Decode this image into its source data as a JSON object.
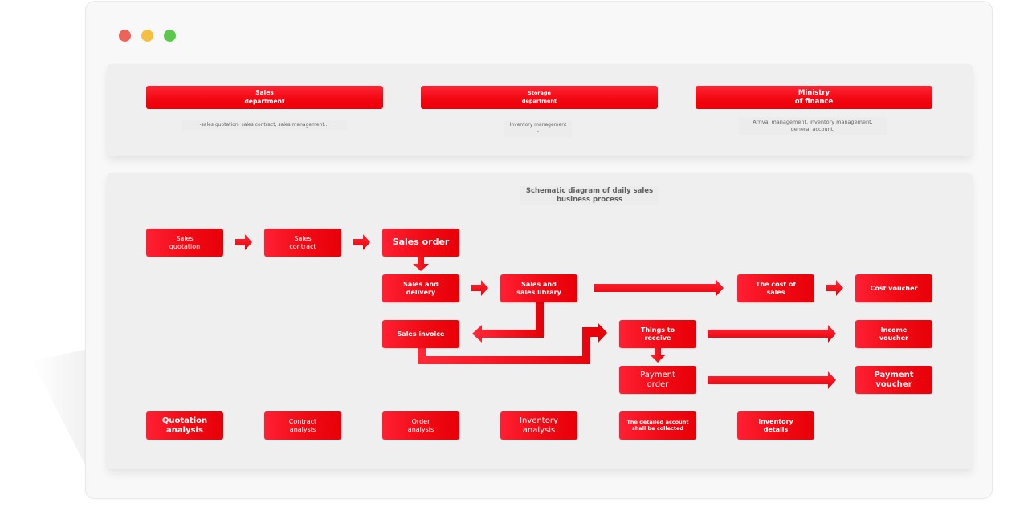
{
  "window": {
    "controls": [
      "close",
      "minimize",
      "maximize"
    ]
  },
  "departments": [
    {
      "title": "Sales\ndepartment",
      "description": "-sales quotation, sales contract, sales management..."
    },
    {
      "title": "Storage\ndepartment",
      "description": "Inventory management -"
    },
    {
      "title": "Ministry\nof finance",
      "description": "Arrival management, inventory management,\ngeneral account,"
    }
  ],
  "diagram": {
    "title": "Schematic diagram of daily sales\nbusiness process",
    "nodes": {
      "sales_quotation": "Sales\nquotation",
      "sales_contract": "Sales\ncontract",
      "sales_order": "Sales order",
      "sales_delivery": "Sales and\ndelivery",
      "sales_library": "Sales and\nsales library",
      "cost_of_sales": "The cost of\nsales",
      "cost_voucher": "Cost voucher",
      "sales_invoice": "Sales invoice",
      "things_to_receive": "Things to\nreceive",
      "income_voucher": "Income\nvoucher",
      "payment_order": "Payment\norder",
      "payment_voucher": "Payment\nvoucher"
    },
    "analysis": [
      "Quotation\nanalysis",
      "Contract\nanalysis",
      "Order\nanalysis",
      "Inventory\nanalysis",
      "The detailed account\nshall be collected",
      "Inventory\ndetails"
    ],
    "edges": [
      {
        "from": "sales_quotation",
        "to": "sales_contract"
      },
      {
        "from": "sales_contract",
        "to": "sales_order"
      },
      {
        "from": "sales_order",
        "to": "sales_delivery"
      },
      {
        "from": "sales_delivery",
        "to": "sales_library"
      },
      {
        "from": "sales_library",
        "to": "cost_of_sales"
      },
      {
        "from": "cost_of_sales",
        "to": "cost_voucher"
      },
      {
        "from": "sales_library",
        "to": "sales_invoice"
      },
      {
        "from": "sales_invoice",
        "to": "things_to_receive"
      },
      {
        "from": "things_to_receive",
        "to": "payment_order"
      },
      {
        "from": "things_to_receive",
        "to": "income_voucher"
      },
      {
        "from": "payment_order",
        "to": "payment_voucher"
      }
    ]
  },
  "colors": {
    "accent": "#f00a14",
    "panel": "#efefef",
    "window": "#f8f8f8",
    "text_muted": "#666666"
  }
}
